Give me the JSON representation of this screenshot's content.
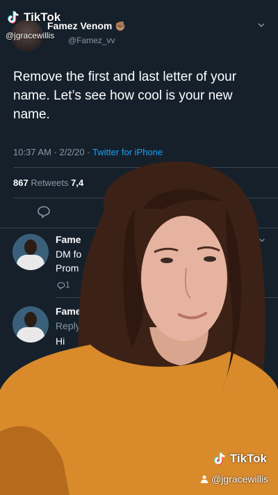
{
  "tweet": {
    "author_name": "Famez Venom",
    "author_emoji": "✊🏽",
    "author_handle": "Famez_vv",
    "text": "Remove the first and last letter of your name. Let’s see how cool is your new name.",
    "timestamp": "10:37 AM · 2/2/20 · ",
    "source": "Twitter for iPhone",
    "retweets_count": "867",
    "retweets_label": "Retweets",
    "likes_count_partial": "7,4"
  },
  "replies": [
    {
      "author_partial": "Fame",
      "line1": "DM fo",
      "line2": "Prom",
      "reply_count": "1"
    },
    {
      "author_partial": "Fame",
      "line1": "Reply",
      "line2": "Hi"
    }
  ],
  "watermark": {
    "brand": "TikTok",
    "username": "@jgracewillis"
  },
  "colors": {
    "background": "#15202b",
    "accent": "#1da1f2",
    "muted": "#8899a6",
    "sweater": "#d98a2a"
  }
}
